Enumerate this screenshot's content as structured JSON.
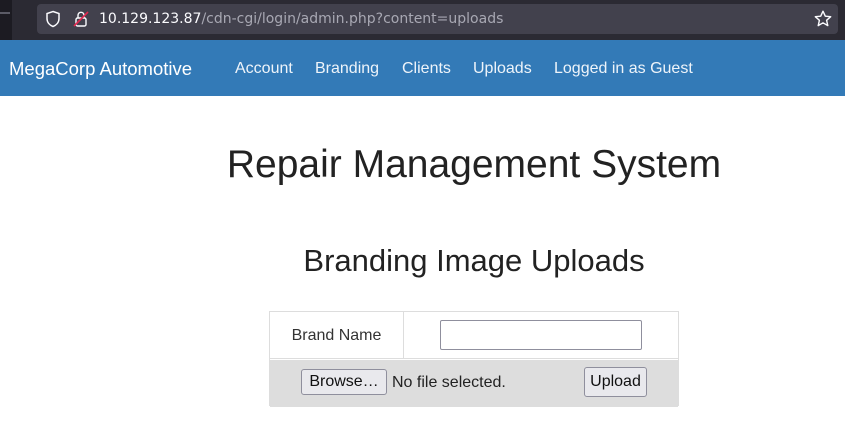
{
  "browser": {
    "url_host": "10.129.123.87",
    "url_path": "/cdn-cgi/login/admin.php?content=uploads",
    "icons": [
      "shield-icon",
      "lock-icon",
      "star-icon"
    ]
  },
  "navbar": {
    "brand": "MegaCorp Automotive",
    "links": [
      "Account",
      "Branding",
      "Clients",
      "Uploads",
      "Logged in as Guest"
    ],
    "background": "#337ab7"
  },
  "main": {
    "title": "Repair Management System",
    "section_title": "Branding Image Uploads"
  },
  "form": {
    "brand_name_label": "Brand Name",
    "brand_name_value": "",
    "browse_label": "Browse…",
    "file_status": "No file selected.",
    "upload_label": "Upload"
  }
}
